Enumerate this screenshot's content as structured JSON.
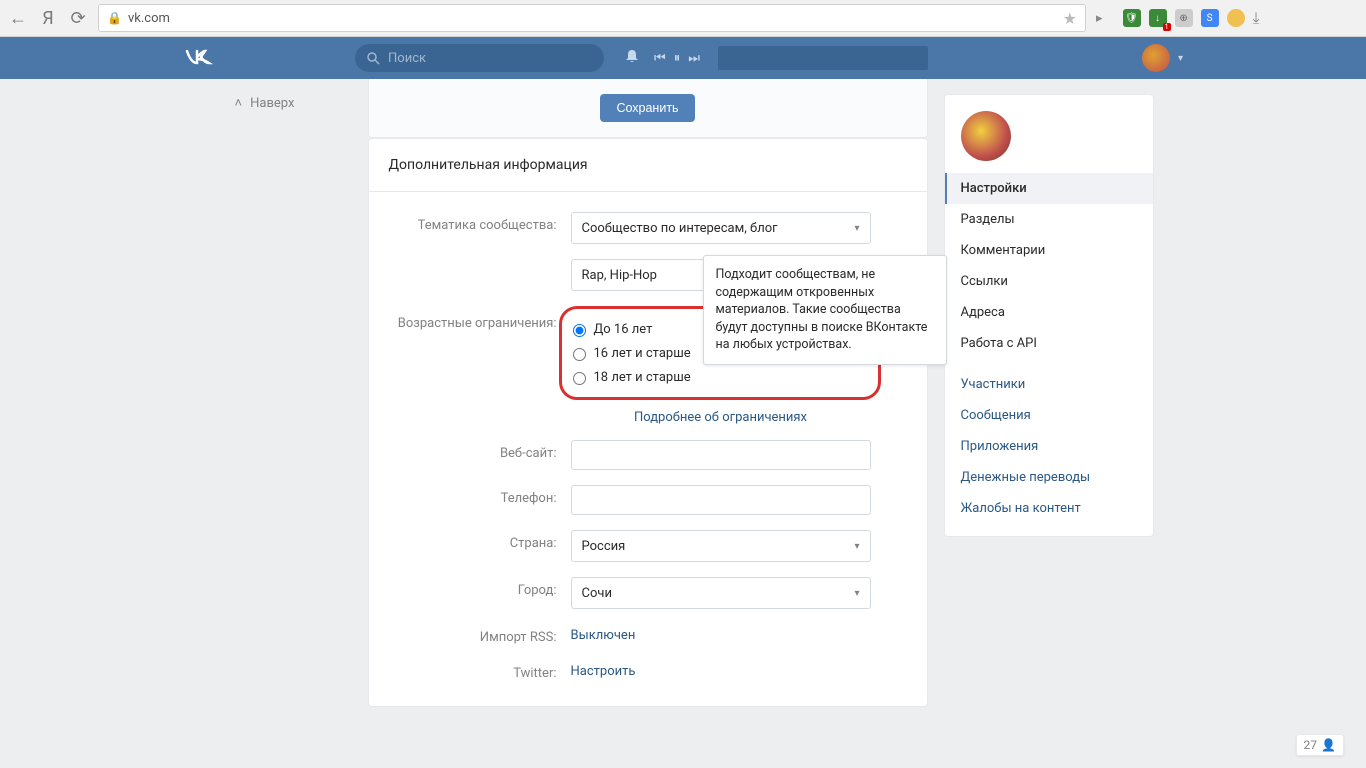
{
  "browser": {
    "url": "vk.com",
    "back_icon": "←",
    "ya_letter": "Я",
    "refresh": "⟳",
    "star": "★",
    "download_badge": "1"
  },
  "header": {
    "logo": "VK",
    "search_placeholder": "Поиск",
    "user_name": "",
    "chev": "▾"
  },
  "scroll_top": "Наверх",
  "save_button": "Сохранить",
  "section_title": "Дополнительная информация",
  "labels": {
    "topic": "Тематика сообщества:",
    "age": "Возрастные ограничения:",
    "website": "Веб-сайт:",
    "phone": "Телефон:",
    "country": "Страна:",
    "city": "Город:",
    "rss": "Импорт RSS:",
    "twitter": "Twitter:"
  },
  "values": {
    "topic_value": "Сообщество по интересам, блог",
    "topic_sub_value": "Rap, Hip-Hop",
    "age_options": [
      "До 16 лет",
      "16 лет и старше",
      "18 лет и старше"
    ],
    "age_selected": 0,
    "more_about_limits": "Подробнее об ограничениях",
    "country": "Россия",
    "city": "Сочи",
    "rss_value": "Выключен",
    "twitter_value": "Настроить"
  },
  "tooltip": "Подходит сообществам, не содержащим откровенных материалов. Такие сообщества будут доступны в поиске ВКонтакте на любых устройствах.",
  "sidebar": {
    "settings": [
      "Настройки",
      "Разделы",
      "Комментарии",
      "Ссылки",
      "Адреса",
      "Работа с API"
    ],
    "links": [
      "Участники",
      "Сообщения",
      "Приложения",
      "Денежные переводы",
      "Жалобы на контент"
    ]
  },
  "friends_count": "27"
}
